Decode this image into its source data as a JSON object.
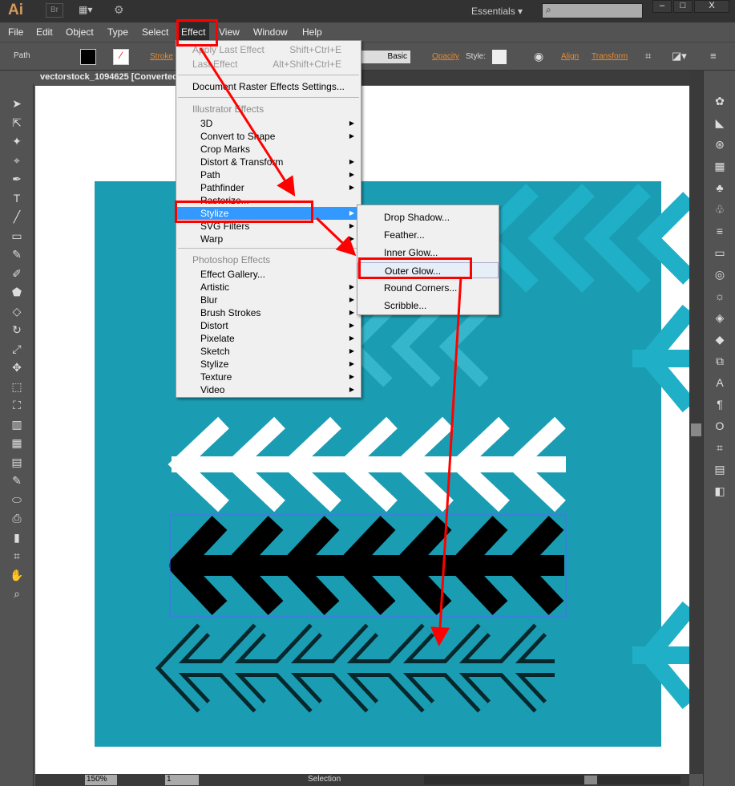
{
  "app": {
    "logo": "Ai",
    "bridge": "Br",
    "workspace": "Essentials",
    "search_placeholder": ""
  },
  "window_controls": {
    "minimize": "–",
    "maximize": "□",
    "close": "X"
  },
  "menubar": [
    "File",
    "Edit",
    "Object",
    "Type",
    "Select",
    "Effect",
    "View",
    "Window",
    "Help"
  ],
  "control": {
    "selection_type": "Path",
    "stroke_label": "Stroke",
    "brush": "Basic",
    "opacity": "Opacity",
    "style": "Style:",
    "align": "Align",
    "transform": "Transform"
  },
  "document": {
    "tab": "vectorstock_1094625 [Converted"
  },
  "effect_menu": {
    "apply_last": {
      "label": "Apply Last Effect",
      "shortcut": "Shift+Ctrl+E"
    },
    "last": {
      "label": "Last Effect",
      "shortcut": "Alt+Shift+Ctrl+E"
    },
    "raster_settings": "Document Raster Effects Settings...",
    "illustrator_header": "Illustrator Effects",
    "illustrator_items": [
      "3D",
      "Convert to Shape",
      "Crop Marks",
      "Distort & Transform",
      "Path",
      "Pathfinder",
      "Rasterize...",
      "Stylize",
      "SVG Filters",
      "Warp"
    ],
    "photoshop_header": "Photoshop Effects",
    "photoshop_items": [
      "Effect Gallery...",
      "Artistic",
      "Blur",
      "Brush Strokes",
      "Distort",
      "Pixelate",
      "Sketch",
      "Stylize",
      "Texture",
      "Video"
    ],
    "highlighted": "Stylize"
  },
  "stylize_submenu": [
    "Drop Shadow...",
    "Feather...",
    "Inner Glow...",
    "Outer Glow...",
    "Round Corners...",
    "Scribble..."
  ],
  "highlighted_submenu": "Outer Glow...",
  "status": {
    "zoom": "150%",
    "page": "1",
    "tool": "Selection"
  },
  "colors": {
    "artwork_bg": "#1a9db3",
    "annotation": "#ff0000",
    "highlight": "#3399ff"
  }
}
